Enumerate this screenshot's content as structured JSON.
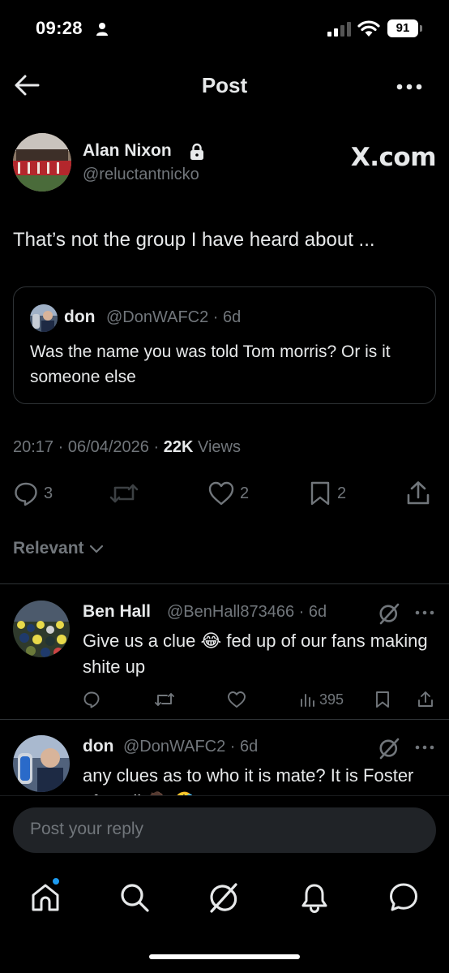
{
  "status_bar": {
    "time": "09:28",
    "battery": "91"
  },
  "header": {
    "title": "Post"
  },
  "post": {
    "author_name": "Alan Nixon",
    "author_handle": "@reluctantnicko",
    "watermark": "X.com",
    "text": "That’s not the group I have heard about ...",
    "quote": {
      "name": "don",
      "handle_time": "@DonWAFC2 · 6d",
      "text": "Was the name you was told Tom morris? Or is it someone else"
    },
    "meta": {
      "time_date": "20:17 · 06/04/2026 · ",
      "views_count": "22K",
      "views_label": " Views"
    },
    "stats": {
      "replies": "3",
      "reposts": "",
      "likes": "2",
      "bookmarks": "2"
    }
  },
  "sort": {
    "label": "Relevant"
  },
  "replies": [
    {
      "name": "Ben Hall",
      "handle_time": "@BenHall873466 · 6d",
      "text_before": "Give us a clue ",
      "emoji": "😂",
      "text_after": " fed up of our fans making shite up",
      "views": "395"
    },
    {
      "name": "don",
      "handle_time": "@DonWAFC2 · 6d",
      "text": "any clues as to who it is mate? It is Foster after all 🤷 🤣"
    }
  ],
  "composer": {
    "placeholder": "Post your reply"
  },
  "colors": {
    "background": "#000000",
    "text": "#e7e9ea",
    "muted": "#71767b",
    "border": "#2f3336",
    "accent": "#1d9bf0"
  }
}
